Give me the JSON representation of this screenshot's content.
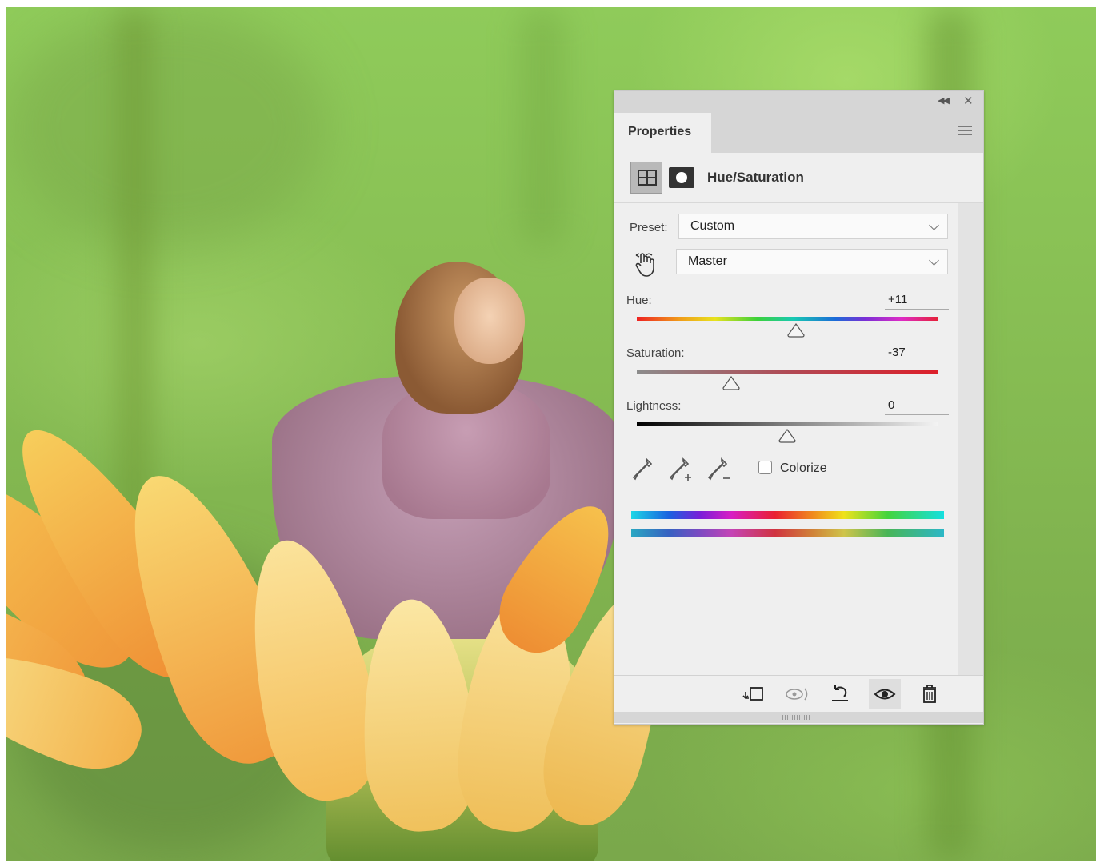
{
  "panel": {
    "tab_label": "Properties",
    "adjustment_title": "Hue/Saturation",
    "preset": {
      "label": "Preset:",
      "value": "Custom"
    },
    "range": {
      "value": "Master"
    },
    "hue": {
      "label": "Hue:",
      "value": "+11",
      "level": 11,
      "min": -180,
      "max": 180
    },
    "saturation": {
      "label": "Saturation:",
      "value": "-37",
      "level": -37,
      "min": -100,
      "max": 100
    },
    "lightness": {
      "label": "Lightness:",
      "value": "0",
      "level": 0,
      "min": -100,
      "max": 100
    },
    "colorize": {
      "label": "Colorize",
      "checked": false
    },
    "footer_icons": [
      "clip-to-layer-icon",
      "view-previous-state-icon",
      "reset-icon",
      "toggle-visibility-icon",
      "delete-icon"
    ],
    "colors": {
      "panel_bg": "#efefef",
      "titlebar": "#d6d6d6",
      "saturation_end": "#dd1f2a"
    }
  }
}
